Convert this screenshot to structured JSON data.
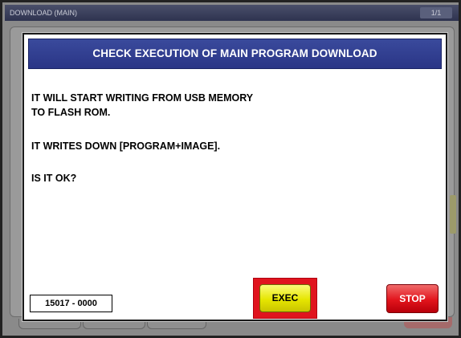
{
  "background": {
    "title": "DOWNLOAD (MAIN)",
    "page": "1/1"
  },
  "dialog": {
    "title": "CHECK EXECUTION OF MAIN PROGRAM DOWNLOAD",
    "message": [
      "IT WILL START WRITING FROM USB MEMORY",
      "TO FLASH ROM.",
      "IT WRITES DOWN [PROGRAM+IMAGE].",
      "IS IT OK?"
    ],
    "code": "15017 - 0000",
    "exec_label": "EXEC",
    "stop_label": "STOP"
  },
  "colors": {
    "header": "#2e3a8f",
    "exec": "#e6e600",
    "exec_highlight": "#e0141e",
    "stop": "#e2141c"
  }
}
